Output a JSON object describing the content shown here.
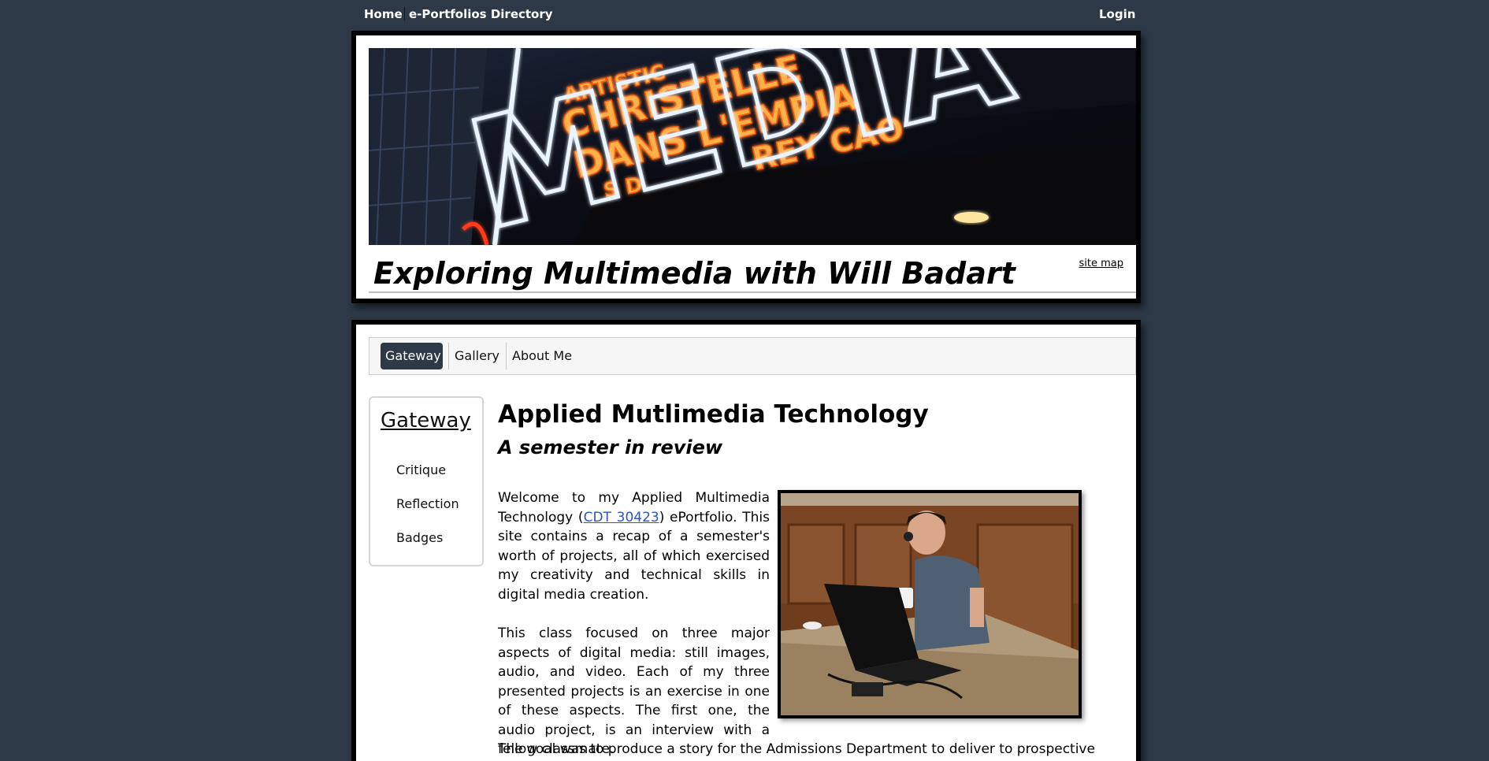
{
  "topbar": {
    "home": "Home",
    "directory": "e-Portfolios Directory",
    "login": "Login"
  },
  "banner": {
    "sign_words": [
      "ARTISTIC",
      "CHRISTELLE",
      "DANS L'EMPIA",
      "MEDIA",
      "REY CAO",
      "S D"
    ]
  },
  "site": {
    "title": "Exploring Multimedia with Will Badart",
    "site_map": "site map"
  },
  "nav": {
    "tabs": [
      "Gateway",
      "Gallery",
      "About Me"
    ]
  },
  "sidebar": {
    "title": "Gateway",
    "items": [
      "Critique",
      "Reflection",
      "Badges"
    ]
  },
  "main": {
    "title": "Applied Mutlimedia Technology",
    "subtitle": "A semester in review",
    "p1_a": "Welcome to my Applied Multimedia Technology (",
    "p1_link": "CDT 30423",
    "p1_b": ") ePortfolio.  This site contains a recap of a semester's worth of projects, all of which exercised my creativity and technical skills in digital media creation.",
    "p2": "This class focused on three major aspects of digital media: still images, audio, and video.  Each of my three presented projects is an exercise in one of these aspects.  The first one, the audio project, is an interview with a fellow classmate.",
    "p3": "The goal was to produce a story for the Admissions Department to deliver to prospective"
  },
  "colors": {
    "page_bg": "#2d3947",
    "active_tab": "#2d3947",
    "link": "#2a55c8",
    "neon_orange": "#ff7a1a",
    "neon_white": "#e8f3ff"
  }
}
